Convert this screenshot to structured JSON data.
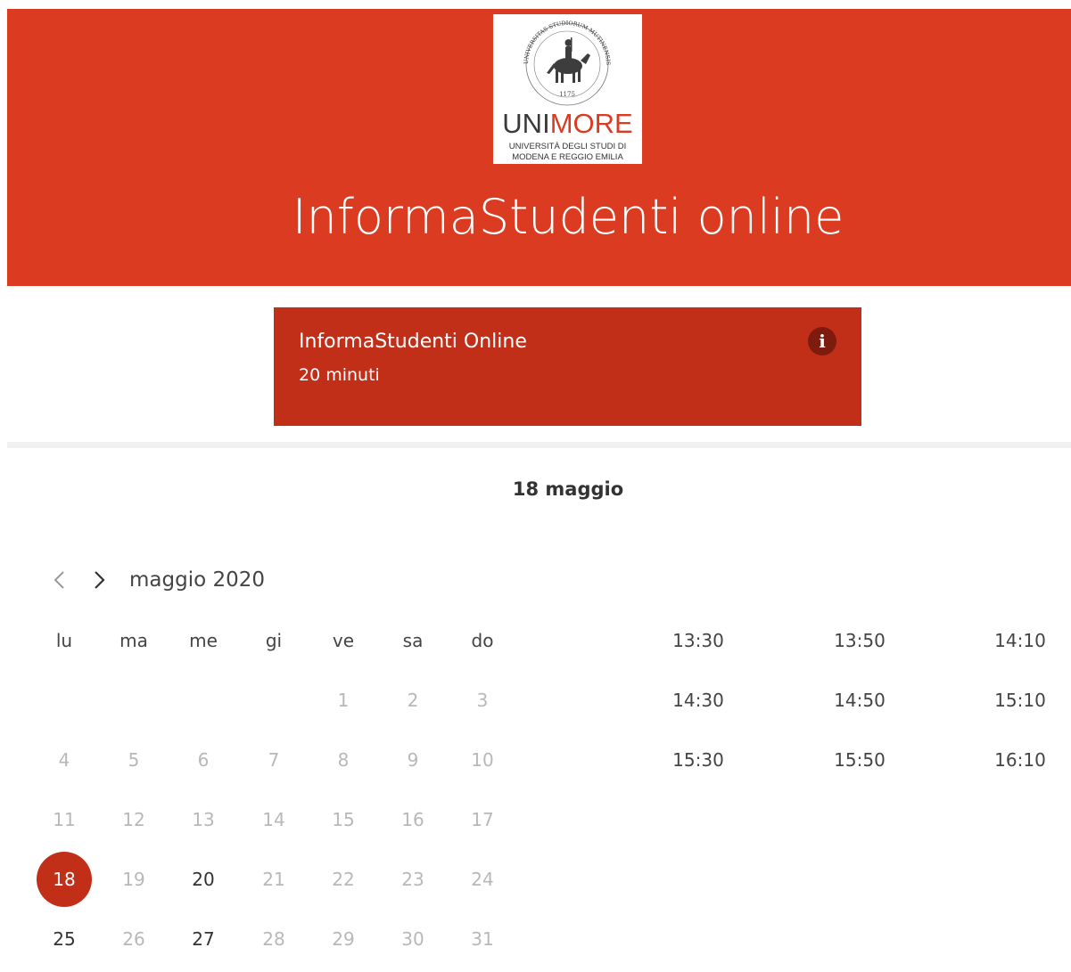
{
  "header": {
    "logo": {
      "seal_text": "UNIVERSITAS STUDIORUM MUTINENSIS ET REGIENSIS",
      "seal_year": "1175",
      "brand_uni": "UNI",
      "brand_more": "MORE",
      "sub_line1": "UNIVERSITÀ DEGLI STUDI DI",
      "sub_line2": "MODENA E REGGIO EMILIA"
    },
    "title": "InformaStudenti online",
    "color": "#db3b20"
  },
  "service": {
    "name": "InformaStudenti Online",
    "duration": "20 minuti",
    "info_icon": "info-icon",
    "color": "#c12f19"
  },
  "selected_date_label": "18 maggio",
  "calendar": {
    "month_label": "maggio 2020",
    "prev_icon": "chevron-left-icon",
    "next_icon": "chevron-right-icon",
    "weekdays": [
      "lu",
      "ma",
      "me",
      "gi",
      "ve",
      "sa",
      "do"
    ],
    "weeks": [
      [
        null,
        null,
        null,
        null,
        {
          "day": "1",
          "state": "disabled"
        },
        {
          "day": "2",
          "state": "disabled"
        },
        {
          "day": "3",
          "state": "disabled"
        }
      ],
      [
        {
          "day": "4",
          "state": "disabled"
        },
        {
          "day": "5",
          "state": "disabled"
        },
        {
          "day": "6",
          "state": "disabled"
        },
        {
          "day": "7",
          "state": "disabled"
        },
        {
          "day": "8",
          "state": "disabled"
        },
        {
          "day": "9",
          "state": "disabled"
        },
        {
          "day": "10",
          "state": "disabled"
        }
      ],
      [
        {
          "day": "11",
          "state": "disabled"
        },
        {
          "day": "12",
          "state": "disabled"
        },
        {
          "day": "13",
          "state": "disabled"
        },
        {
          "day": "14",
          "state": "disabled"
        },
        {
          "day": "15",
          "state": "disabled"
        },
        {
          "day": "16",
          "state": "disabled"
        },
        {
          "day": "17",
          "state": "disabled"
        }
      ],
      [
        {
          "day": "18",
          "state": "selected"
        },
        {
          "day": "19",
          "state": "disabled"
        },
        {
          "day": "20",
          "state": "available"
        },
        {
          "day": "21",
          "state": "disabled"
        },
        {
          "day": "22",
          "state": "disabled"
        },
        {
          "day": "23",
          "state": "disabled"
        },
        {
          "day": "24",
          "state": "disabled"
        }
      ],
      [
        {
          "day": "25",
          "state": "available"
        },
        {
          "day": "26",
          "state": "disabled"
        },
        {
          "day": "27",
          "state": "available"
        },
        {
          "day": "28",
          "state": "disabled"
        },
        {
          "day": "29",
          "state": "disabled"
        },
        {
          "day": "30",
          "state": "disabled"
        },
        {
          "day": "31",
          "state": "disabled"
        }
      ]
    ]
  },
  "time_slots": [
    "13:30",
    "13:50",
    "14:10",
    "14:30",
    "14:50",
    "15:10",
    "15:30",
    "15:50",
    "16:10"
  ]
}
